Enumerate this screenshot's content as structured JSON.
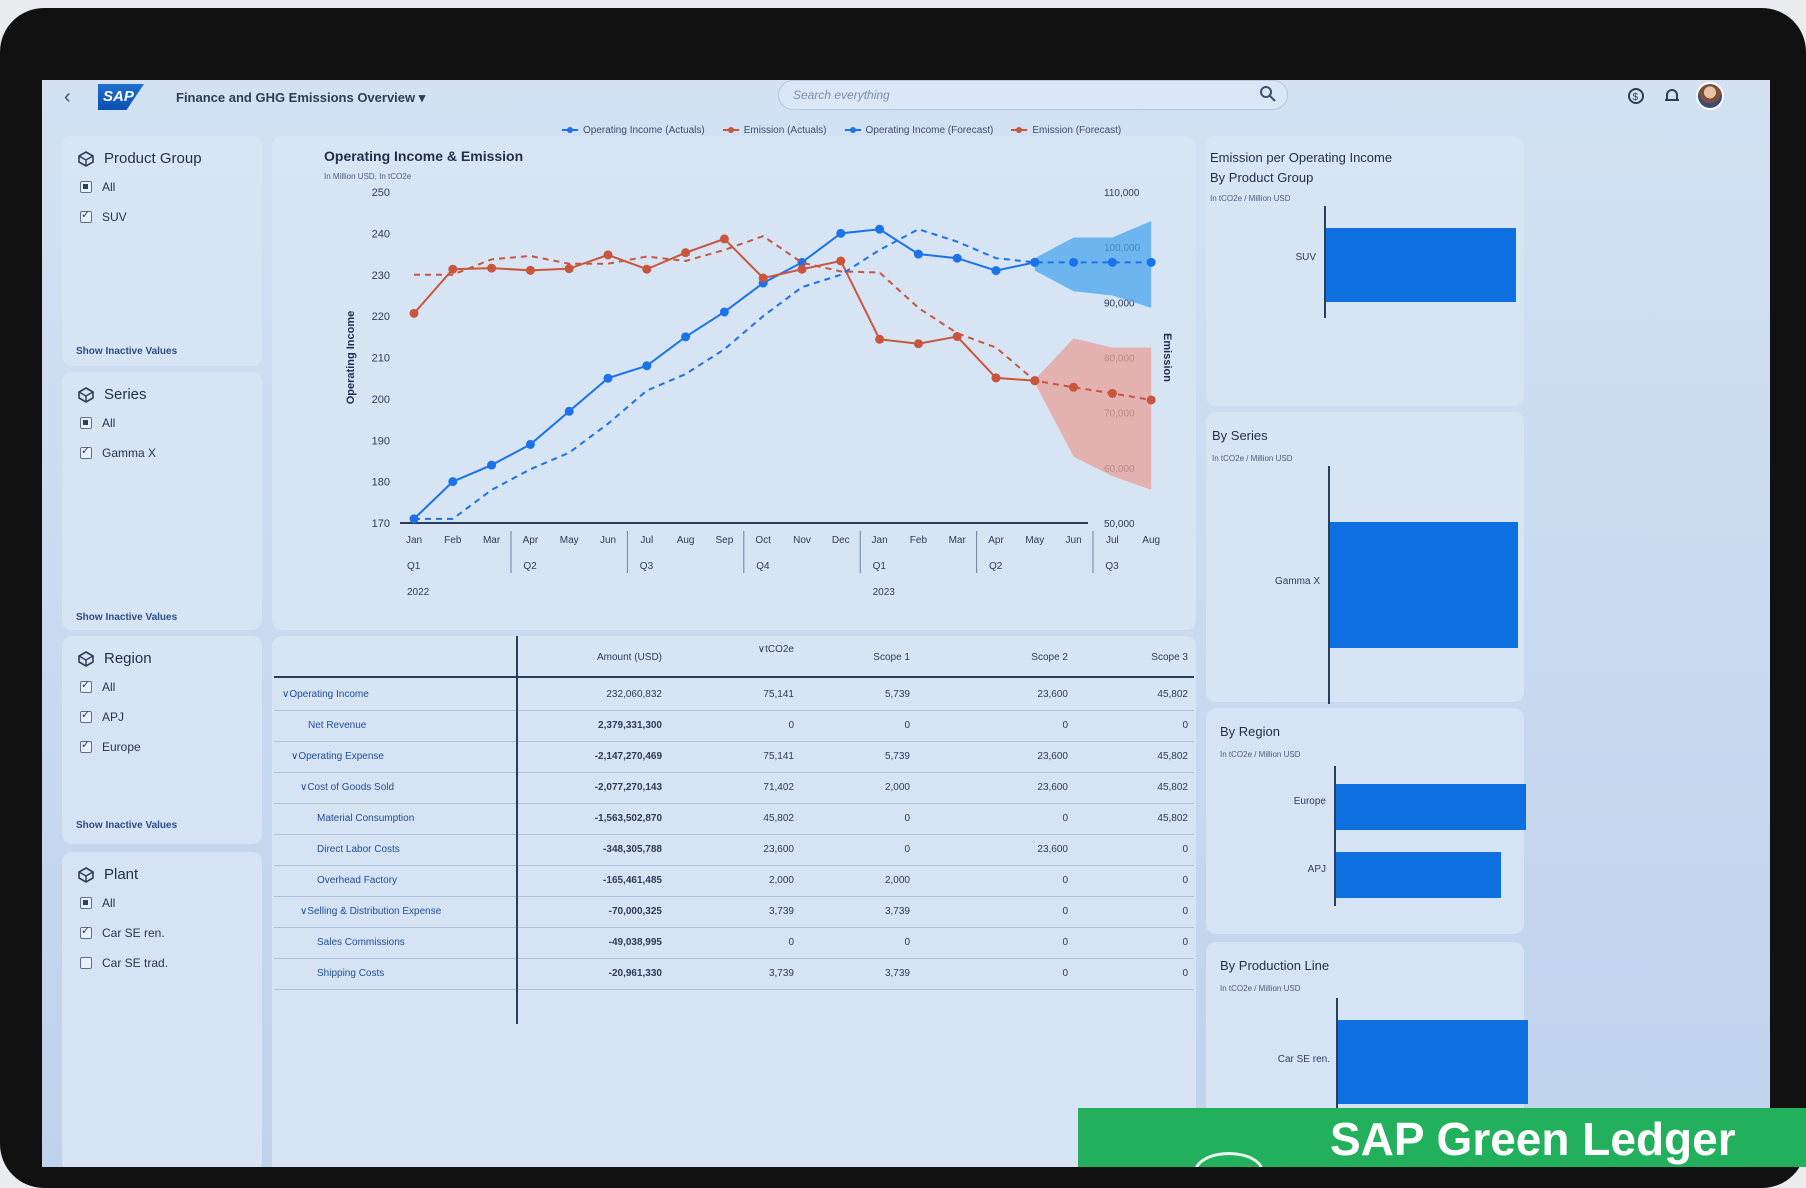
{
  "shell": {
    "back_icon": "chevron-left-icon",
    "logo": "SAP",
    "app_title": "Finance and GHG Emissions Overview",
    "search_placeholder": "Search everything",
    "icons": [
      "search-icon",
      "coin-icon",
      "bell-icon",
      "avatar"
    ]
  },
  "legend": [
    {
      "label": "Operating Income (Actuals)",
      "color": "#1a73e8"
    },
    {
      "label": "Emission (Actuals)",
      "color": "#c9553d"
    },
    {
      "label": "Operating Income (Forecast)",
      "color": "#1a73e8"
    },
    {
      "label": "Emission (Forecast)",
      "color": "#c9553d"
    }
  ],
  "filters": {
    "product_group": {
      "title": "Product Group",
      "options": [
        {
          "label": "All",
          "state": "partial"
        },
        {
          "label": "SUV",
          "state": "checked"
        }
      ],
      "show_inactive": "Show Inactive Values"
    },
    "series": {
      "title": "Series",
      "options": [
        {
          "label": "All",
          "state": "partial"
        },
        {
          "label": "Gamma X",
          "state": "checked"
        }
      ],
      "show_inactive": "Show Inactive Values"
    },
    "region": {
      "title": "Region",
      "options": [
        {
          "label": "All",
          "state": "checked"
        },
        {
          "label": "APJ",
          "state": "checked"
        },
        {
          "label": "Europe",
          "state": "checked"
        }
      ],
      "show_inactive": "Show Inactive Values"
    },
    "plant": {
      "title": "Plant",
      "options": [
        {
          "label": "All",
          "state": "partial"
        },
        {
          "label": "Car SE ren.",
          "state": "checked"
        },
        {
          "label": "Car SE trad.",
          "state": "unchecked"
        }
      ]
    }
  },
  "chart_data": [
    {
      "type": "line",
      "title": "Operating Income & Emission",
      "subtitle": "In Million USD, In tCO2e",
      "ylabel": "Operating Income",
      "y2label": "Emission",
      "ylim": [
        170,
        250
      ],
      "y2lim": [
        50000,
        110000
      ],
      "yticks": [
        "250",
        "240",
        "230",
        "220",
        "210",
        "200",
        "190",
        "180",
        "170"
      ],
      "y2ticks": [
        "110,000",
        "100,000",
        "90,000",
        "80,000",
        "70,000",
        "60,000",
        "50,000"
      ],
      "x_months": [
        "Jan",
        "Feb",
        "Mar",
        "Apr",
        "May",
        "Jun",
        "Jul",
        "Aug",
        "Sep",
        "Oct",
        "Nov",
        "Dec",
        "Jan",
        "Feb",
        "Mar",
        "Apr",
        "May",
        "Jun",
        "Jul",
        "Aug"
      ],
      "x_quarters": [
        {
          "label": "Q1",
          "index": 0
        },
        {
          "label": "Q2",
          "index": 3
        },
        {
          "label": "Q3",
          "index": 6
        },
        {
          "label": "Q4",
          "index": 9
        },
        {
          "label": "Q1",
          "index": 12
        },
        {
          "label": "Q2",
          "index": 15
        },
        {
          "label": "Q3",
          "index": 18
        }
      ],
      "x_years": [
        {
          "label": "2022",
          "index": 0
        },
        {
          "label": "2023",
          "index": 12
        }
      ],
      "grid": false,
      "series": [
        {
          "name": "Operating Income (Actuals)",
          "axis": "left",
          "style": "solid",
          "color": "#1a73e8",
          "x_index": [
            0,
            1,
            2,
            3,
            4,
            5,
            6,
            7,
            8,
            9,
            10,
            11,
            12,
            13,
            14,
            15,
            16
          ],
          "values": [
            171,
            180,
            184,
            189,
            197,
            205,
            208,
            215,
            221,
            228,
            233,
            240,
            241,
            235,
            234,
            231,
            233
          ]
        },
        {
          "name": "Emission (Actuals)",
          "axis": "right",
          "style": "solid",
          "color": "#c9553d",
          "x_index": [
            0,
            1,
            2,
            3,
            4,
            5,
            6,
            7,
            8,
            9,
            10,
            11,
            12,
            13,
            14,
            15,
            16
          ],
          "values": [
            88000,
            96000,
            96200,
            95800,
            96100,
            98600,
            96000,
            99000,
            101500,
            94400,
            96000,
            97500,
            83300,
            82500,
            83800,
            76300,
            75800
          ]
        },
        {
          "name": "Operating Income (Forecast)",
          "axis": "left",
          "style": "dashed",
          "color": "#1a73e8",
          "x_index": [
            0,
            1,
            2,
            3,
            4,
            5,
            6,
            7,
            8,
            9,
            10,
            11,
            12,
            13,
            14,
            15,
            16,
            17,
            18,
            19
          ],
          "values": [
            171,
            171,
            178,
            183,
            187,
            194,
            202,
            206,
            212,
            220,
            227,
            230,
            236,
            241,
            238,
            234,
            233,
            233,
            233,
            233
          ]
        },
        {
          "name": "Emission (Forecast)",
          "axis": "right",
          "style": "dashed",
          "color": "#c9553d",
          "x_index": [
            0,
            1,
            2,
            3,
            4,
            5,
            6,
            7,
            8,
            9,
            10,
            11,
            12,
            13,
            14,
            15,
            16,
            17,
            18,
            19
          ],
          "values": [
            95000,
            95000,
            97800,
            98400,
            97000,
            97000,
            98300,
            97500,
            99500,
            102000,
            97200,
            95600,
            95400,
            89000,
            84400,
            81800,
            75800,
            74600,
            73500,
            72300
          ]
        },
        {
          "name": "Operating Income Forecast Band",
          "axis": "left",
          "style": "band",
          "color": "#4aa6ee",
          "x_index": [
            16,
            17,
            18,
            19
          ],
          "upper": [
            234,
            239,
            239,
            243
          ],
          "lower": [
            231,
            226,
            225,
            222
          ]
        },
        {
          "name": "Emission Forecast Band",
          "axis": "right",
          "style": "band",
          "color": "#e7a29a",
          "x_index": [
            16,
            17,
            18,
            19
          ],
          "upper": [
            76000,
            83500,
            81800,
            81800
          ],
          "lower": [
            75400,
            62000,
            58500,
            56000
          ]
        }
      ]
    },
    {
      "type": "bar",
      "title": "Emission per Operating Income\nBy Product Group",
      "subtitle": "In tCO2e / Million USD",
      "categories": [
        "SUV"
      ],
      "values": [
        1.0
      ]
    },
    {
      "type": "bar",
      "title": "By Series",
      "subtitle": "In tCO2e / Million USD",
      "categories": [
        "Gamma X"
      ],
      "values": [
        1.0
      ]
    },
    {
      "type": "bar",
      "title": "By Region",
      "subtitle": "In tCO2e / Million USD",
      "categories": [
        "Europe",
        "APJ"
      ],
      "values": [
        1.0,
        0.87
      ]
    },
    {
      "type": "bar",
      "title": "By Production Line",
      "subtitle": "In tCO2e / Million USD",
      "categories": [
        "Car SE ren."
      ],
      "values": [
        1.0
      ]
    }
  ],
  "table": {
    "columns": [
      "Amount (USD)",
      "tCO2e",
      "Scope 1",
      "Scope 2",
      "Scope 3"
    ],
    "rows": [
      {
        "label": "Operating Income",
        "indent": 0,
        "expand": true,
        "cells": [
          "232,060,832",
          "75,141",
          "5,739",
          "23,600",
          "45,802"
        ]
      },
      {
        "label": "Net Revenue",
        "indent": 2,
        "expand": false,
        "cells": [
          "2,379,331,300",
          "0",
          "0",
          "0",
          "0"
        ]
      },
      {
        "label": "Operating Expense",
        "indent": 1,
        "expand": true,
        "cells": [
          "-2,147,270,469",
          "75,141",
          "5,739",
          "23,600",
          "45,802"
        ]
      },
      {
        "label": "Cost of Goods Sold",
        "indent": 2,
        "expand": true,
        "cells": [
          "-2,077,270,143",
          "71,402",
          "2,000",
          "23,600",
          "45,802"
        ]
      },
      {
        "label": "Material Consumption",
        "indent": 3,
        "expand": false,
        "cells": [
          "-1,563,502,870",
          "45,802",
          "0",
          "0",
          "45,802"
        ]
      },
      {
        "label": "Direct Labor Costs",
        "indent": 3,
        "expand": false,
        "cells": [
          "-348,305,788",
          "23,600",
          "0",
          "23,600",
          "0"
        ]
      },
      {
        "label": "Overhead Factory",
        "indent": 3,
        "expand": false,
        "cells": [
          "-165,461,485",
          "2,000",
          "2,000",
          "0",
          "0"
        ]
      },
      {
        "label": "Selling & Distribution Expense",
        "indent": 2,
        "expand": true,
        "cells": [
          "-70,000,325",
          "3,739",
          "3,739",
          "0",
          "0"
        ]
      },
      {
        "label": "Sales Commissions",
        "indent": 3,
        "expand": false,
        "cells": [
          "-49,038,995",
          "0",
          "0",
          "0",
          "0"
        ]
      },
      {
        "label": "Shipping Costs",
        "indent": 3,
        "expand": false,
        "cells": [
          "-20,961,330",
          "3,739",
          "3,739",
          "0",
          "0"
        ]
      }
    ]
  },
  "banner": {
    "text": "SAP Green Ledger",
    "color": "#22b05d"
  }
}
